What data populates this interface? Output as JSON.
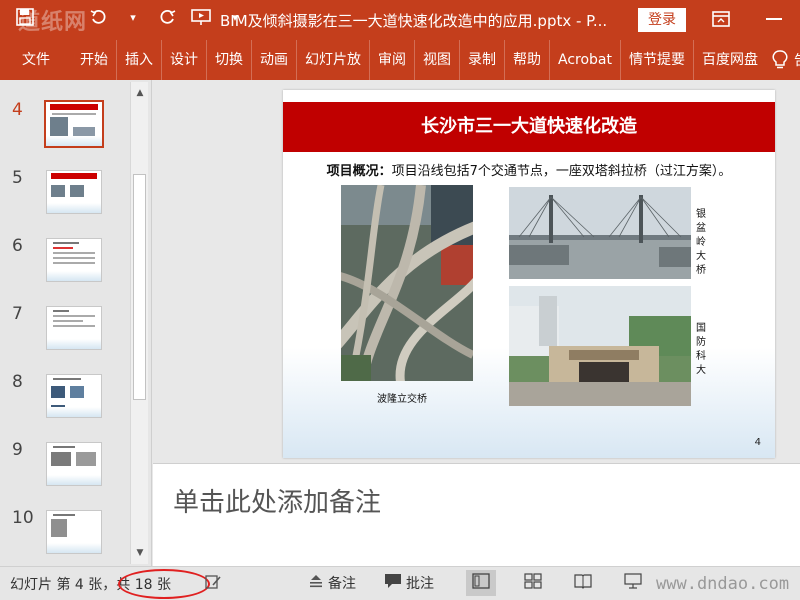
{
  "titlebar": {
    "watermark": "道纸网",
    "doc_title": "BIM及倾斜摄影在三一大道快速化改造中的应用.pptx  -  P...",
    "login_label": "登录"
  },
  "ribbon": {
    "tabs": [
      "文件",
      "开始",
      "插入",
      "设计",
      "切换",
      "动画",
      "幻灯片放",
      "审阅",
      "视图",
      "录制",
      "帮助",
      "Acrobat",
      "情节提要",
      "百度网盘"
    ],
    "tell_me": "告诉我"
  },
  "thumbnails": [
    {
      "number": "4",
      "active": true
    },
    {
      "number": "5",
      "active": false
    },
    {
      "number": "6",
      "active": false
    },
    {
      "number": "7",
      "active": false
    },
    {
      "number": "8",
      "active": false
    },
    {
      "number": "9",
      "active": false
    },
    {
      "number": "10",
      "active": false
    }
  ],
  "slide": {
    "title": "长沙市三一大道快速化改造",
    "subtitle_bold": "项目概况：",
    "subtitle_rest": "项目沿线包括7个交通节点，一座双塔斜拉桥（过江方案）。",
    "caption_interchange": "波隆立交桥",
    "caption_bridge": "银盆岭大桥",
    "caption_university": "国防科大",
    "page_number": "4",
    "colors": {
      "title_bar": "#c00000"
    }
  },
  "notes": {
    "placeholder": "单击此处添加备注"
  },
  "status": {
    "slide_info": "幻灯片 第 4 张，共 18 张",
    "notes_label": "备注",
    "comments_label": "批注",
    "watermark": "www.dndao.com"
  },
  "colors": {
    "accent": "#c43e1c",
    "highlight_ellipse": "#e02020"
  }
}
